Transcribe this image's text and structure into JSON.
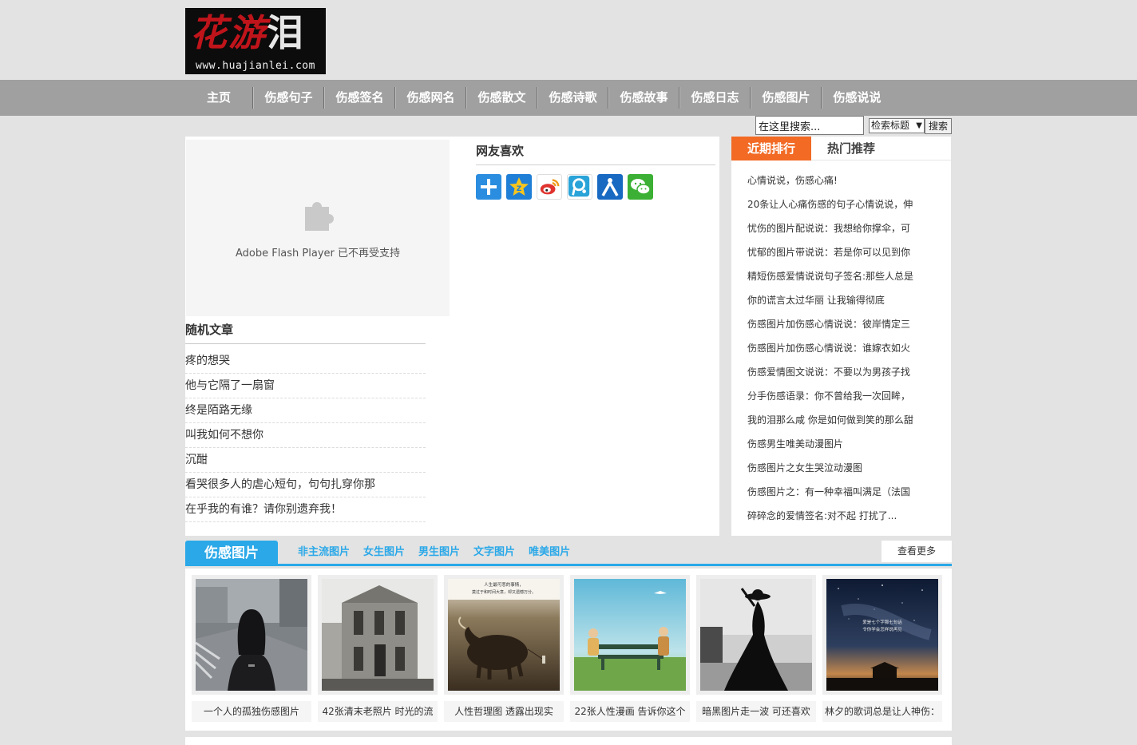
{
  "brand": {
    "logo_text": "花游泪",
    "url_text": "www.huajianlei.com"
  },
  "nav": {
    "items": [
      "主页",
      "伤感句子",
      "伤感签名",
      "伤感网名",
      "伤感散文",
      "伤感诗歌",
      "伤感故事",
      "伤感日志",
      "伤感图片",
      "伤感说说"
    ]
  },
  "search": {
    "value": "在这里搜索...",
    "select_value": "检索标题",
    "button_label": "搜索"
  },
  "flash": {
    "message": "Adobe Flash Player 已不再受支持"
  },
  "random": {
    "title": "随机文章",
    "items": [
      "疼的想哭",
      "他与它隔了一扇窗",
      "终是陌路无缘",
      "叫我如何不想你",
      "沉酣",
      "看哭很多人的虐心短句，句句扎穿你那",
      "在乎我的有谁？请你别遗弃我！"
    ]
  },
  "favorites": {
    "title": "网友喜欢"
  },
  "share_icons": [
    {
      "name": "share-more-icon",
      "color": "#2b8de0"
    },
    {
      "name": "qzone-icon",
      "color": "#1f7fd6"
    },
    {
      "name": "weibo-icon",
      "color": "#e0332f"
    },
    {
      "name": "tencent-weibo-icon",
      "color": "#2aa3d8"
    },
    {
      "name": "renren-icon",
      "color": "#1769c2"
    },
    {
      "name": "wechat-icon",
      "color": "#3cb034"
    }
  ],
  "sidebar": {
    "tabs": [
      "近期排行",
      "热门推荐"
    ],
    "items": [
      "心情说说，伤感心痛!",
      "20条让人心痛伤感的句子心情说说，伸",
      "忧伤的图片配说说：我想给你撑伞，可",
      "忧郁的图片带说说：若是你可以见到你",
      "精短伤感爱情说说句子签名:那些人总是",
      "你的谎言太过华丽 让我输得彻底",
      "伤感图片加伤感心情说说：彼岸情定三",
      "伤感图片加伤感心情说说：谁嫁衣如火",
      "伤感爱情图文说说：不要以为男孩子找",
      "分手伤感语录：你不曾给我一次回眸，",
      "我的泪那么咸 你是如何做到笑的那么甜",
      "伤感男生唯美动漫图片",
      "伤感图片之女生哭泣动漫图",
      "伤感图片之：有一种幸福叫满足（法国",
      "碎碎念的爱情签名:对不起 打扰了..."
    ]
  },
  "photos": {
    "tab": "伤感图片",
    "categories": [
      "非主流图片",
      "女生图片",
      "男生图片",
      "文字图片",
      "唯美图片"
    ],
    "more": "查看更多",
    "cards": [
      {
        "caption": "一个人的孤独伤感图片",
        "image": "girl-back-street"
      },
      {
        "caption": "42张清末老照片 时光的流",
        "image": "old-building"
      },
      {
        "caption": "人性哲理图 透露出现实",
        "image": "bull-illustration",
        "overlay_text": [
          "人生最可悲的事情，",
          "莫过于和时间大意，却又遗憾万分。"
        ]
      },
      {
        "caption": "22张人性漫画 告诉你这个",
        "image": "bench-cartoon"
      },
      {
        "caption": "暗黑图片走一波 可还喜欢",
        "image": "woman-black-dress"
      },
      {
        "caption": "林夕的歌词总是让人神伤：",
        "image": "starry-night",
        "overlay_text": [
          "爱是七个字那七句话",
          "令你学会怎样说再见"
        ]
      }
    ]
  }
}
